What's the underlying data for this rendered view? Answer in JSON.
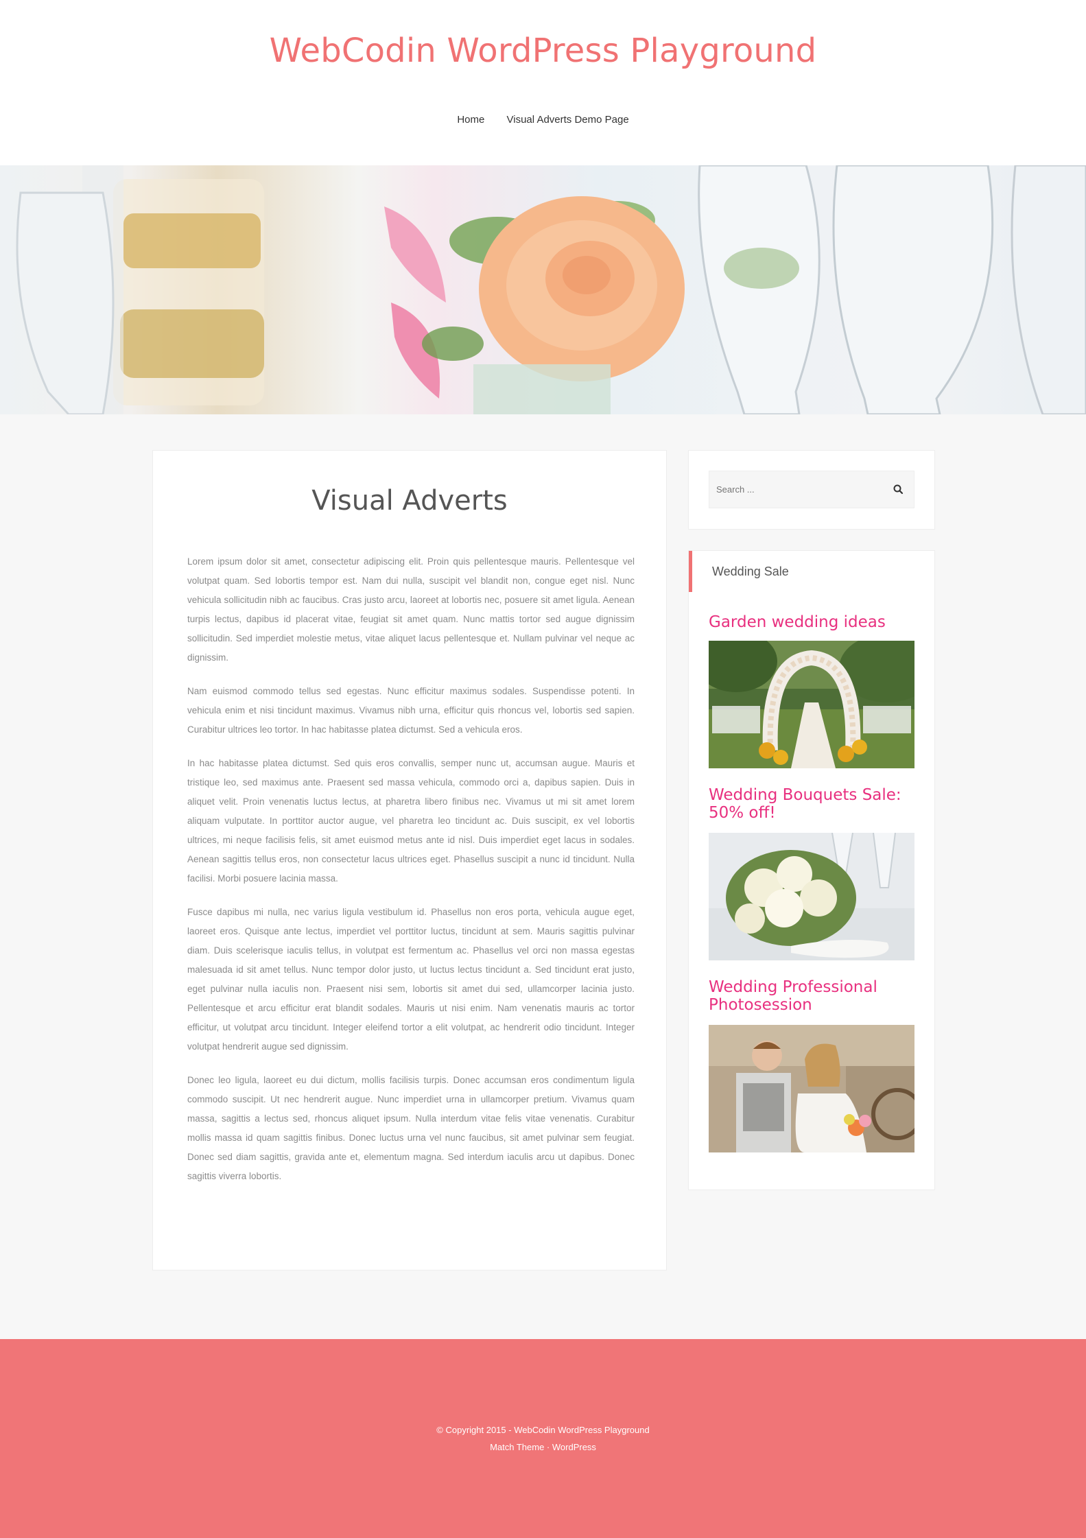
{
  "header": {
    "site_title": "WebCodin WordPress Playground",
    "nav": [
      "Home",
      "Visual Adverts Demo Page"
    ]
  },
  "article": {
    "title": "Visual Adverts",
    "paragraphs": [
      "Lorem ipsum dolor sit amet, consectetur adipiscing elit. Proin quis pellentesque mauris. Pellentesque vel volutpat quam. Sed lobortis tempor est. Nam dui nulla, suscipit vel blandit non, congue eget nisl. Nunc vehicula sollicitudin nibh ac faucibus. Cras justo arcu, laoreet at lobortis nec, posuere sit amet ligula. Aenean turpis lectus, dapibus id placerat vitae, feugiat sit amet quam. Nunc mattis tortor sed augue dignissim sollicitudin. Sed imperdiet molestie metus, vitae aliquet lacus pellentesque et. Nullam pulvinar vel neque ac dignissim.",
      "Nam euismod commodo tellus sed egestas. Nunc efficitur maximus sodales. Suspendisse potenti. In vehicula enim et nisi tincidunt maximus. Vivamus nibh urna, efficitur quis rhoncus vel, lobortis sed sapien. Curabitur ultrices leo tortor. In hac habitasse platea dictumst. Sed a vehicula eros.",
      "In hac habitasse platea dictumst. Sed quis eros convallis, semper nunc ut, accumsan augue. Mauris et tristique leo, sed maximus ante. Praesent sed massa vehicula, commodo orci a, dapibus sapien. Duis in aliquet velit. Proin venenatis luctus lectus, at pharetra libero finibus nec. Vivamus ut mi sit amet lorem aliquam vulputate. In porttitor auctor augue, vel pharetra leo tincidunt ac. Duis suscipit, ex vel lobortis ultrices, mi neque facilisis felis, sit amet euismod metus ante id nisl. Duis imperdiet eget lacus in sodales. Aenean sagittis tellus eros, non consectetur lacus ultrices eget. Phasellus suscipit a nunc id tincidunt. Nulla facilisi. Morbi posuere lacinia massa.",
      "Fusce dapibus mi nulla, nec varius ligula vestibulum id. Phasellus non eros porta, vehicula augue eget, laoreet eros. Quisque ante lectus, imperdiet vel porttitor luctus, tincidunt at sem. Mauris sagittis pulvinar diam. Duis scelerisque iaculis tellus, in volutpat est fermentum ac. Phasellus vel orci non massa egestas malesuada id sit amet tellus. Nunc tempor dolor justo, ut luctus lectus tincidunt a. Sed tincidunt erat justo, eget pulvinar nulla iaculis non. Praesent nisi sem, lobortis sit amet dui sed, ullamcorper lacinia justo. Pellentesque et arcu efficitur erat blandit sodales. Mauris ut nisi enim. Nam venenatis mauris ac tortor efficitur, ut volutpat arcu tincidunt. Integer eleifend tortor a elit volutpat, ac hendrerit odio tincidunt. Integer volutpat hendrerit augue sed dignissim.",
      "Donec leo ligula, laoreet eu dui dictum, mollis facilisis turpis. Donec accumsan eros condimentum ligula commodo suscipit. Ut nec hendrerit augue. Nunc imperdiet urna in ullamcorper pretium. Vivamus quam massa, sagittis a lectus sed, rhoncus aliquet ipsum. Nulla interdum vitae felis vitae venenatis. Curabitur mollis massa id quam sagittis finibus. Donec luctus urna vel nunc faucibus, sit amet pulvinar sem feugiat. Donec sed diam sagittis, gravida ante et, elementum magna. Sed interdum iaculis arcu ut dapibus. Donec sagittis viverra lobortis."
    ]
  },
  "sidebar": {
    "search_placeholder": "Search ...",
    "ads_widget_title": "Wedding Sale",
    "ads": [
      {
        "heading": "Garden wedding ideas"
      },
      {
        "heading": "Wedding Bouquets Sale: 50% off!"
      },
      {
        "heading": "Wedding Professional Photosession"
      }
    ]
  },
  "footer": {
    "copyright": "© Copyright 2015 - WebCodin WordPress Playground",
    "theme_link": "Match Theme",
    "separator": " · ",
    "wp_link": "WordPress"
  },
  "colors": {
    "accent": "#f07273",
    "ad_heading": "#e8307f",
    "footer_bg": "#f07577"
  }
}
